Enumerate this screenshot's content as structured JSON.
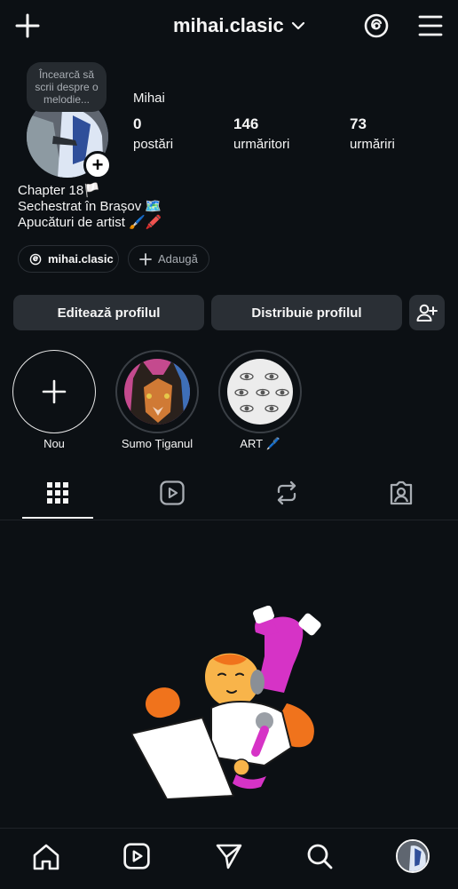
{
  "header": {
    "username": "mihai.clasic"
  },
  "profile": {
    "note": "Încearcă să scrii despre o melodie...",
    "display_name": "Mihai",
    "stats": [
      {
        "value": "0",
        "label": "postări"
      },
      {
        "value": "146",
        "label": "urmăritori"
      },
      {
        "value": "73",
        "label": "urmăriri"
      }
    ],
    "bio": [
      "Chapter 18🏳️",
      "Sechestrat în Brașov 🗺️",
      "Apucături de artist 🖌️🖍️"
    ],
    "links": {
      "threads": "mihai.clasic",
      "add": "Adaugă"
    }
  },
  "actions": {
    "edit": "Editează profilul",
    "share": "Distribuie profilul"
  },
  "highlights": [
    {
      "label": "Nou"
    },
    {
      "label": "Sumo Țiganul"
    },
    {
      "label": "ART 🖊️"
    }
  ],
  "colors": {
    "background": "#0c1014",
    "button": "#2a2f35",
    "accent_magenta": "#d633c6",
    "accent_orange": "#f0731c"
  }
}
